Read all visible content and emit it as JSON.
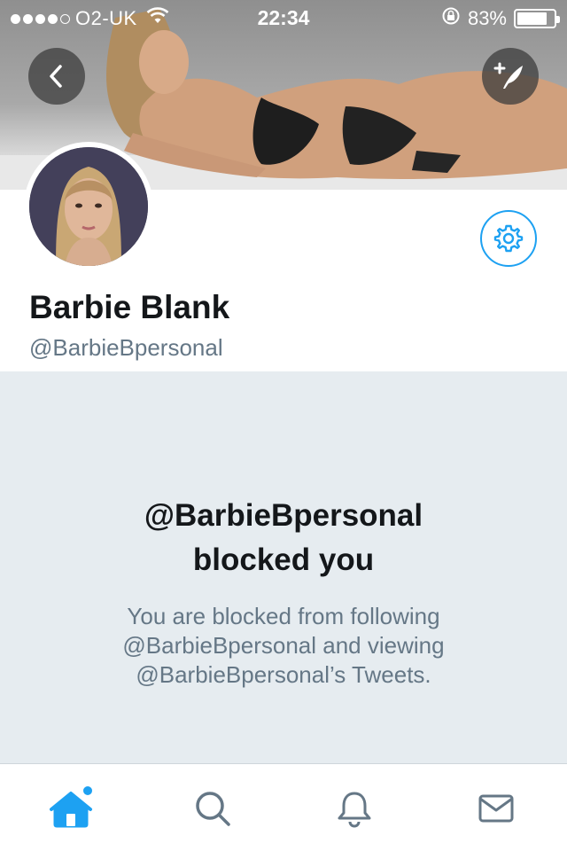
{
  "status_bar": {
    "carrier": "O2-UK",
    "time": "22:34",
    "battery": "83%",
    "battery_level": 0.83,
    "signal_bars": 4,
    "icons": [
      "signal-dots-icon",
      "wifi-icon",
      "rotation-lock-icon",
      "battery-icon"
    ]
  },
  "header": {
    "back_icon": "chevron-left-icon",
    "compose_icon": "compose-tweet-icon"
  },
  "profile": {
    "display_name": "Barbie Blank",
    "handle": "@BarbieBpersonal",
    "settings_icon": "gear-icon"
  },
  "blocked": {
    "title_line1": "@BarbieBpersonal",
    "title_line2": "blocked you",
    "message_line1": "You are blocked from following",
    "message_line2": "@BarbieBpersonal and viewing",
    "message_line3": "@BarbieBpersonal’s Tweets."
  },
  "tab_bar": {
    "tabs": [
      {
        "icon": "home-icon",
        "active": true
      },
      {
        "icon": "search-icon",
        "active": false
      },
      {
        "icon": "bell-icon",
        "active": false
      },
      {
        "icon": "mail-icon",
        "active": false
      }
    ]
  },
  "colors": {
    "accent": "#1da1f2",
    "text_primary": "#14171a",
    "text_secondary": "#657786",
    "blocked_bg": "#e6ecf0"
  }
}
